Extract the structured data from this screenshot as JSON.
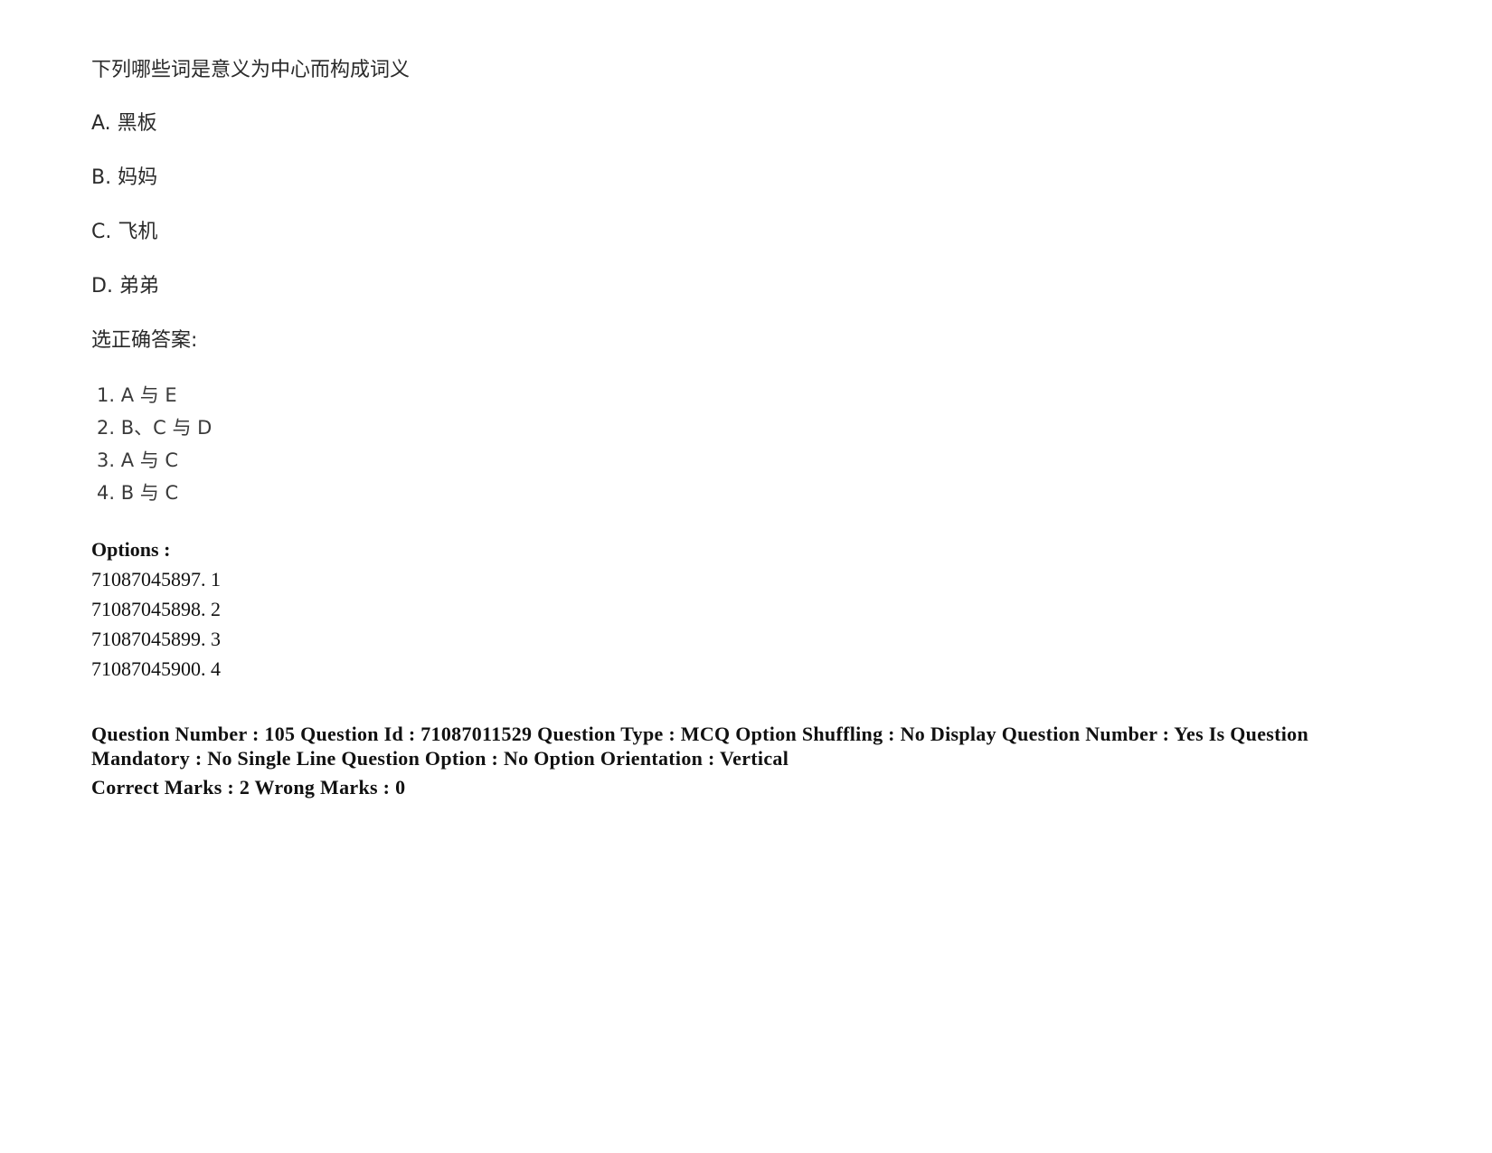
{
  "question": {
    "text": "下列哪些词是意义为中心而构成词义",
    "items": [
      "A. 黑板",
      "B. 妈妈",
      "C. 飞机",
      "D. 弟弟"
    ],
    "prompt": "选正确答案:",
    "answer_choices": [
      "1. A 与 E",
      "2. B、C 与 D",
      "3. A 与 C",
      "4. B 与 C"
    ]
  },
  "options": {
    "heading": "Options :",
    "list": [
      "71087045897. 1",
      "71087045898. 2",
      "71087045899. 3",
      "71087045900. 4"
    ]
  },
  "meta": {
    "line1": "Question Number : 105 Question Id : 71087011529 Question Type : MCQ Option Shuffling : No Display Question Number : Yes Is Question Mandatory : No Single Line Question Option : No Option Orientation : Vertical",
    "marks": "Correct Marks : 2 Wrong Marks : 0"
  }
}
